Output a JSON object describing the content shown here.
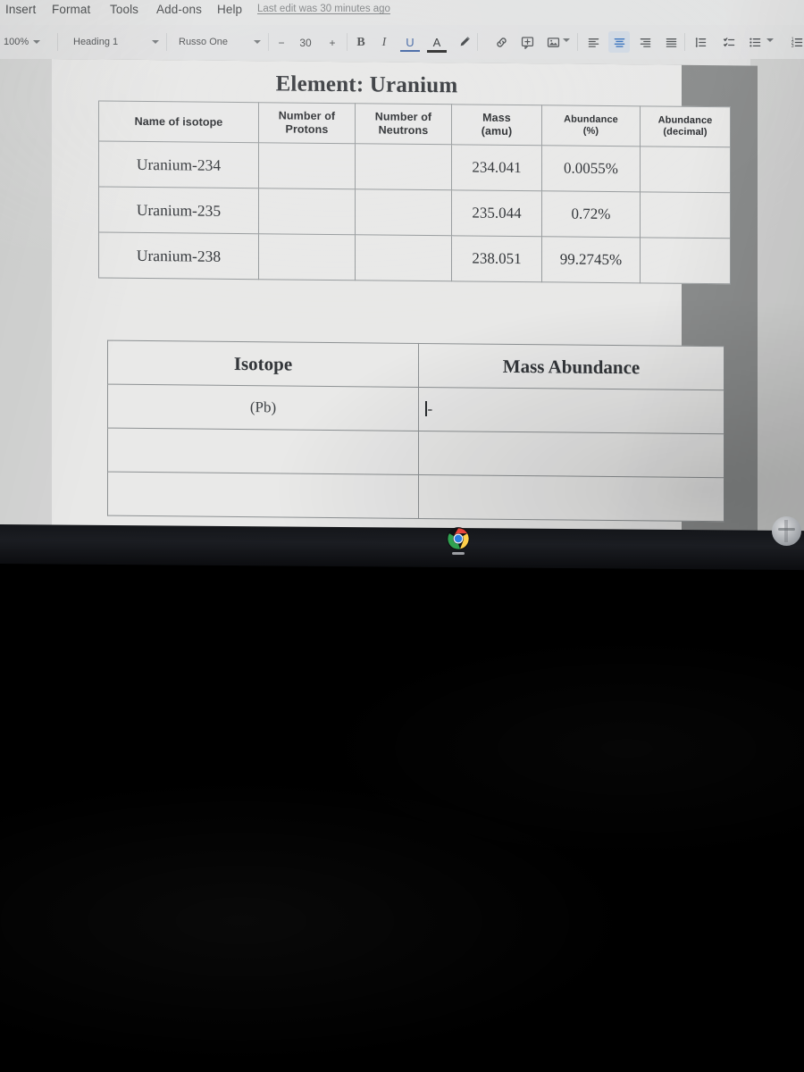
{
  "app": {
    "name": "Google Docs",
    "menu_items": [
      "Insert",
      "Format",
      "Tools",
      "Add-ons",
      "Help"
    ],
    "last_edit": "Last edit was 30 minutes ago"
  },
  "toolbar": {
    "zoom": "100%",
    "paragraph_style": "Heading 1",
    "font": "Russo One",
    "font_size": "30",
    "decrease_size": "−",
    "increase_size": "+",
    "bold": "B",
    "italic": "I",
    "underline": "U",
    "text_color": "A",
    "icons": [
      "zoom-dropdown-icon",
      "paragraph-style-dropdown-icon",
      "font-dropdown-icon",
      "decrease-font-size-icon",
      "increase-font-size-icon",
      "bold-icon",
      "italic-icon",
      "underline-icon",
      "text-color-icon",
      "highlight-color-icon",
      "insert-link-icon",
      "add-comment-icon",
      "insert-image-icon",
      "align-left-icon",
      "align-center-icon",
      "align-right-icon",
      "align-justify-icon",
      "line-spacing-icon",
      "checklist-icon",
      "bulleted-list-icon",
      "numbered-list-icon"
    ],
    "active_alignment": "align-center",
    "accent_color": "#1a73e8",
    "active_highlight_color": "#d6e2f2"
  },
  "document": {
    "title": "Element: Uranium",
    "table1": {
      "headers": [
        "Name of isotope",
        "Number of Protons",
        "Number of Neutrons",
        "Mass (amu)",
        "Abundance (%)",
        "Abundance (decimal)"
      ],
      "header_lines": [
        [
          "Name of isotope"
        ],
        [
          "Number of",
          "Protons"
        ],
        [
          "Number of",
          "Neutrons"
        ],
        [
          "Mass",
          "(amu)"
        ],
        [
          "Abundance",
          "(%)"
        ],
        [
          "Abundance",
          "(decimal)"
        ]
      ],
      "rows": [
        [
          "Uranium-234",
          "",
          "",
          "234.041",
          "0.0055%",
          ""
        ],
        [
          "Uranium-235",
          "",
          "",
          "235.044",
          "0.72%",
          ""
        ],
        [
          "Uranium-238",
          "",
          "",
          "238.051",
          "99.2745%",
          ""
        ]
      ]
    },
    "table2": {
      "headers": [
        "Isotope",
        "Mass Abundance"
      ],
      "rows": [
        [
          "(Pb)",
          "-"
        ],
        [
          "",
          ""
        ],
        [
          "",
          ""
        ]
      ],
      "cursor_cell": {
        "row": 0,
        "column": 1
      }
    }
  },
  "shelf": {
    "items": [
      {
        "label": "Google Chrome",
        "icon": "chrome-icon",
        "active": true
      }
    ],
    "tray": {
      "icon": "status-tray-icon"
    }
  }
}
